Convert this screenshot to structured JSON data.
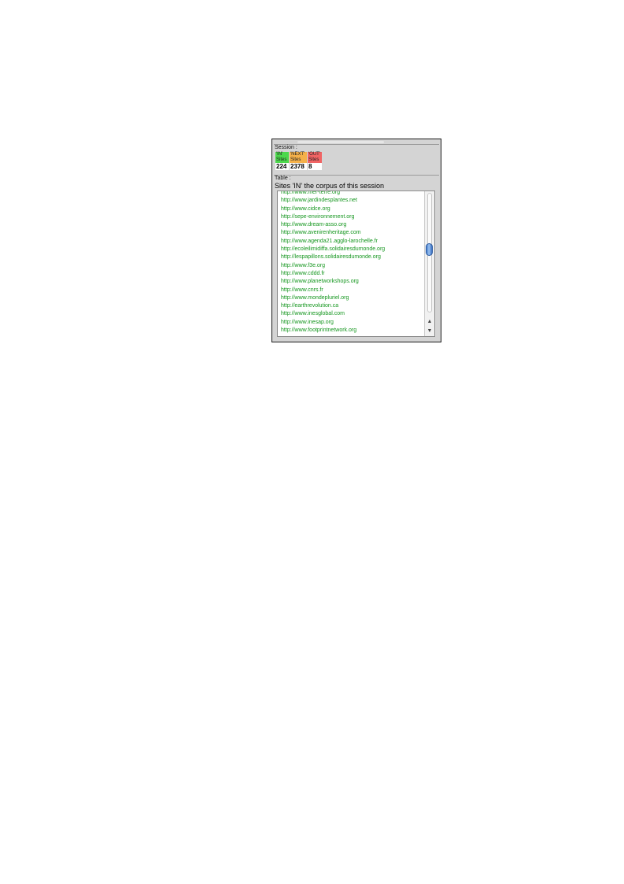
{
  "session": {
    "label": "Session :",
    "stats": [
      {
        "line1": "'IN'",
        "line2": "Sites",
        "count": "224"
      },
      {
        "line1": "'NEXT'",
        "line2": "Sites",
        "count": "2378"
      },
      {
        "line1": "'OUT'",
        "line2": "Sites",
        "count": "8"
      }
    ]
  },
  "table": {
    "label": "Table :",
    "title": "Sites 'IN' the corpus of this session",
    "items": [
      "http://www.mer-terre.org",
      "http://www.jardindesplantes.net",
      "http://www.cidce.org",
      "http://sepe-environnement.org",
      "http://www.dream-asso.org",
      "http://www.avenirenheritage.com",
      "http://www.agenda21.agglo-larochelle.fr",
      "http://ecoleilimidiffa.solidairesdumonde.org",
      "http://lespapillons.solidairesdumonde.org",
      "http://www.f3e.org",
      "http://www.cddd.fr",
      "http://www.planetworkshops.org",
      "http://www.cnrs.fr",
      "http://www.mondepluriel.org",
      "http://earthrevolution.ca",
      "http://www.inesglobal.com",
      "http://www.inesap.org",
      "http://www.footprintnetwork.org"
    ]
  },
  "scrollbar": {
    "up_glyph": "▲",
    "down_glyph": "▼"
  },
  "colors": {
    "in": "#4cd84c",
    "next": "#f5b14a",
    "out": "#f06464",
    "link": "#14961e"
  }
}
